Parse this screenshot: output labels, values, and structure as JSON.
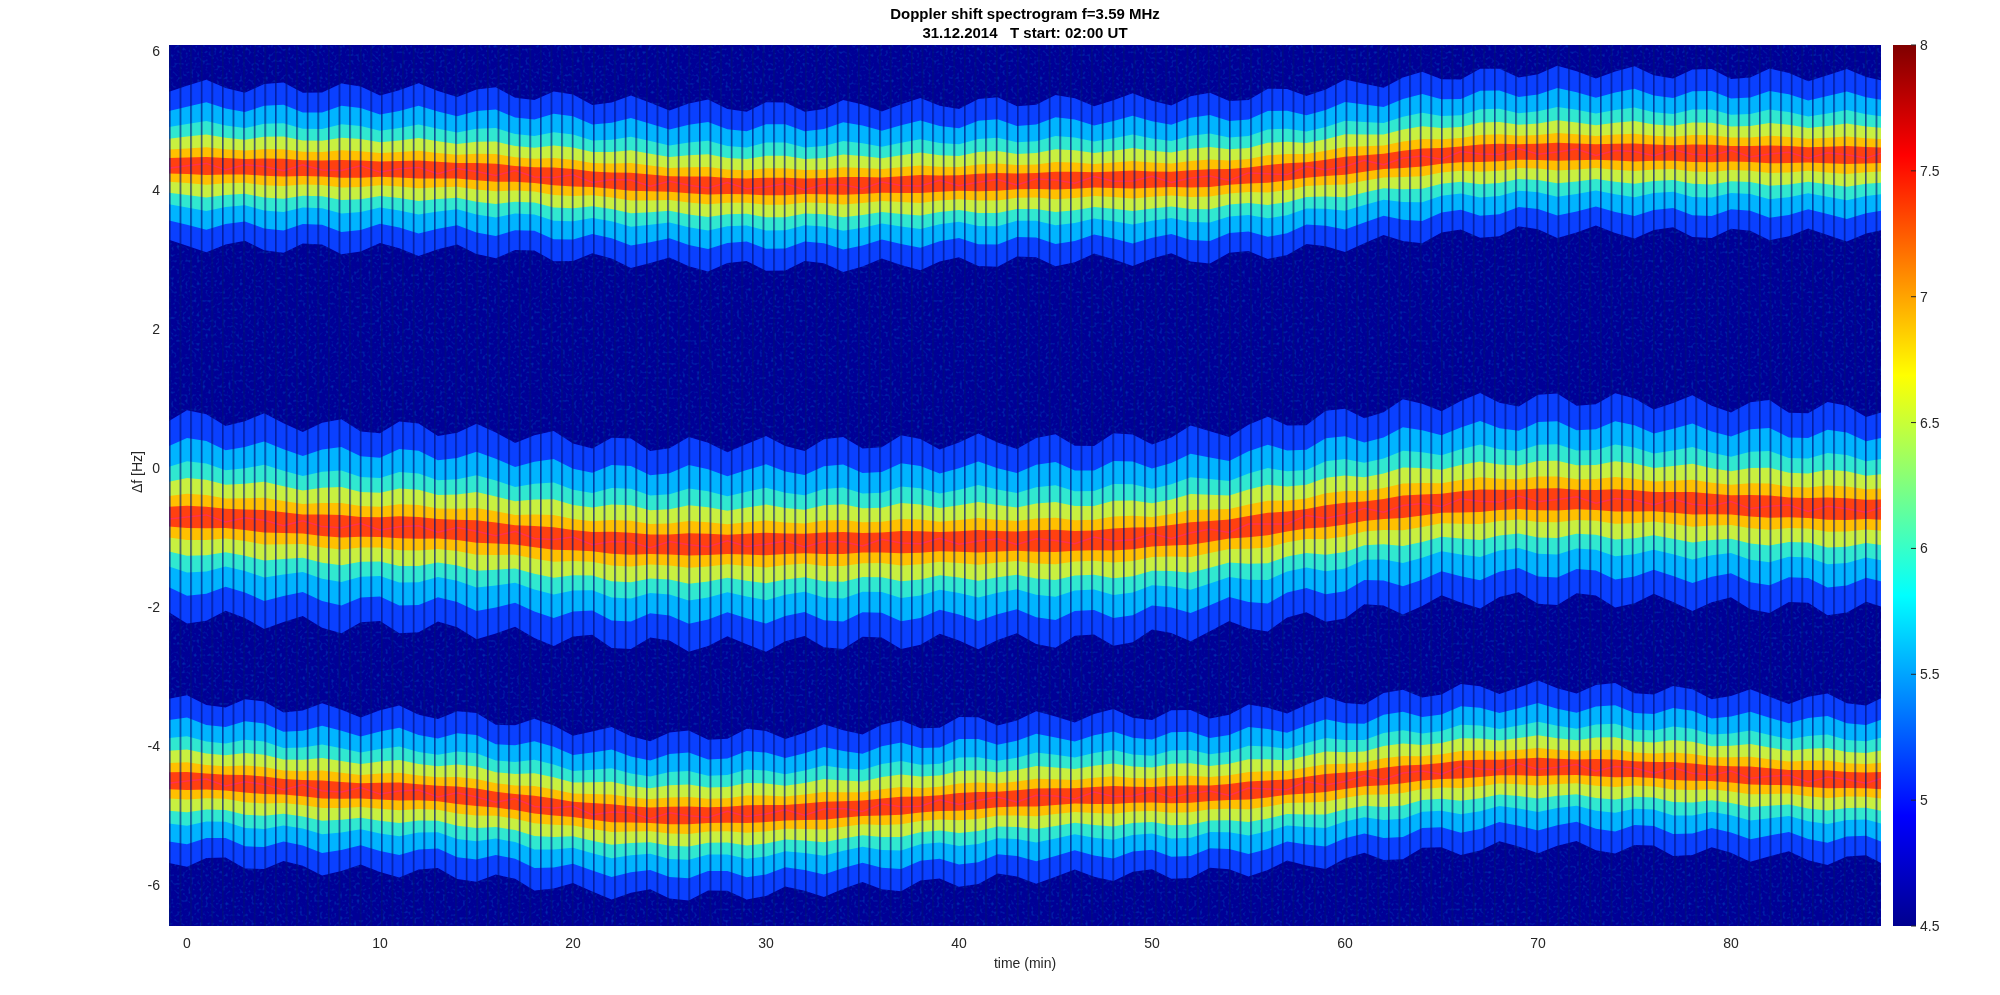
{
  "figure": {
    "title": [
      "Doppler shift spectrogram f=3.59 MHz",
      "31.12.2014   T start: 02:00 UT"
    ],
    "xlabel": "time (min)",
    "ylabel": "Δf [Hz]",
    "xticks": [
      "0",
      "10",
      "20",
      "30",
      "40",
      "50",
      "60",
      "70",
      "80"
    ],
    "yticks": [
      "6",
      "4",
      "2",
      "0",
      "-2",
      "-4",
      "-6"
    ],
    "colorbar": {
      "ticks": [
        "8",
        "7.5",
        "7",
        "6.5",
        "6",
        "5.5",
        "5",
        "4.5"
      ]
    }
  }
}
